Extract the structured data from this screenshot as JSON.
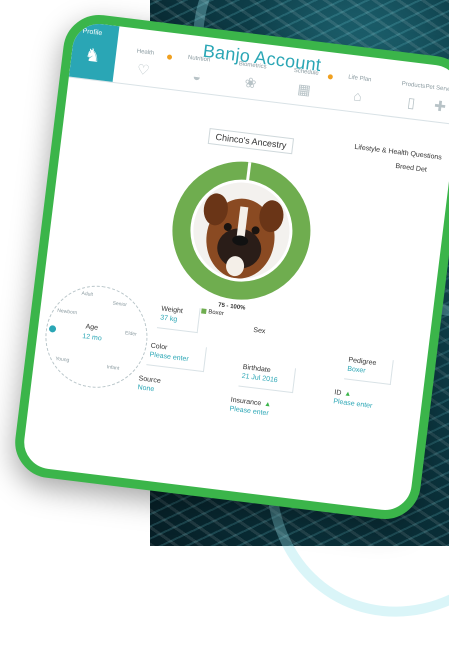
{
  "header": {
    "title": "Banjo Account",
    "tabs": [
      {
        "label": "Profile",
        "icon": "dog-icon",
        "active": true
      },
      {
        "label": "Health",
        "icon": "heart-icon",
        "alert": true
      },
      {
        "label": "Nutrition",
        "icon": "bowl-icon"
      },
      {
        "label": "Biometrics",
        "icon": "paw-icon"
      },
      {
        "label": "Schedule",
        "icon": "calendar-icon",
        "alert": true
      },
      {
        "label": "Life Plan",
        "icon": "steps-icon"
      },
      {
        "label": "Products",
        "icon": "bottle-icon"
      },
      {
        "label": "Pet Services",
        "icon": "services-icon"
      }
    ]
  },
  "ancestry": {
    "title": "Chinco's Ancestry",
    "percent_label": "75 - 100%",
    "breed": "Boxer",
    "breed_color": "#6fad4f"
  },
  "side_links": {
    "questions": "Lifestyle & Health Questions",
    "breed_details": "Breed Det"
  },
  "age_dial": {
    "label": "Age",
    "value": "12 mo",
    "segments": [
      "Newborn",
      "Adult",
      "Senior",
      "Elder",
      "Infant",
      "Young"
    ]
  },
  "fields": {
    "weight": {
      "label": "Weight",
      "value": "37 kg"
    },
    "sex": {
      "label": "Sex",
      "value": ""
    },
    "pedigree": {
      "label": "Pedigree",
      "value": "Boxer"
    },
    "color": {
      "label": "Color",
      "value": "Please enter"
    },
    "birthdate": {
      "label": "Birthdate",
      "value": "21 Jul 2016"
    },
    "source": {
      "label": "Source",
      "value": "None"
    },
    "insurance": {
      "label": "Insurance",
      "value": "Please enter"
    },
    "id": {
      "label": "ID",
      "value": "Please enter"
    }
  },
  "colors": {
    "accent": "#2aa6b5",
    "frame": "#3bb54a",
    "ring": "#6fad4f",
    "alert": "#f0a020"
  }
}
